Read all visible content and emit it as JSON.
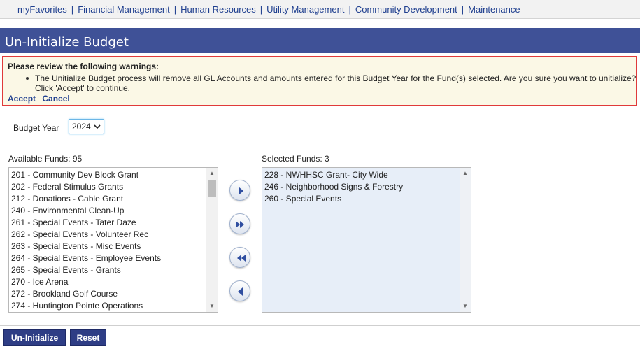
{
  "nav": {
    "items": [
      "myFavorites",
      "Financial Management",
      "Human Resources",
      "Utility Management",
      "Community Development",
      "Maintenance"
    ],
    "separator": "|"
  },
  "page_title": "Un-Initialize Budget",
  "warning": {
    "title": "Please review the following warnings:",
    "message": "The Unitialize Budget process will remove all GL Accounts and amounts entered for this Budget Year for the Fund(s) selected. Are you sure you want to unitialize? Click 'Accept' to continue.",
    "accept_label": "Accept",
    "cancel_label": "Cancel"
  },
  "budget_year": {
    "label": "Budget Year",
    "value": "2024"
  },
  "available": {
    "label": "Available Funds: 95",
    "items": [
      "201 - Community Dev Block Grant",
      "202 - Federal Stimulus Grants",
      "212 - Donations - Cable Grant",
      "240 - Environmental Clean-Up",
      "261 - Special Events - Tater Daze",
      "262 - Special Events - Volunteer Rec",
      "263 - Special Events - Misc Events",
      "264 - Special Events - Employee Events",
      "265 - Special Events - Grants",
      "270 - Ice Arena",
      "272 - Brookland Golf Course",
      "274 - Huntington Pointe Operations"
    ]
  },
  "selected": {
    "label": "Selected Funds: 3",
    "items": [
      "228 - NWHHSC Grant- City Wide",
      "246 - Neighborhood Signs & Forestry",
      "260 - Special Events"
    ]
  },
  "buttons": {
    "uninitialize": "Un-Initialize",
    "reset": "Reset"
  },
  "icons": {
    "move_right": "arrow-right-icon",
    "move_all_right": "double-arrow-right-icon",
    "move_all_left": "double-arrow-left-icon",
    "move_left": "arrow-left-icon"
  },
  "colors": {
    "header": "#3f5197",
    "nav_link": "#1f3f8f",
    "warning_border": "#e03a3a",
    "warning_bg": "#fbf8e6",
    "button": "#2e3d85"
  }
}
